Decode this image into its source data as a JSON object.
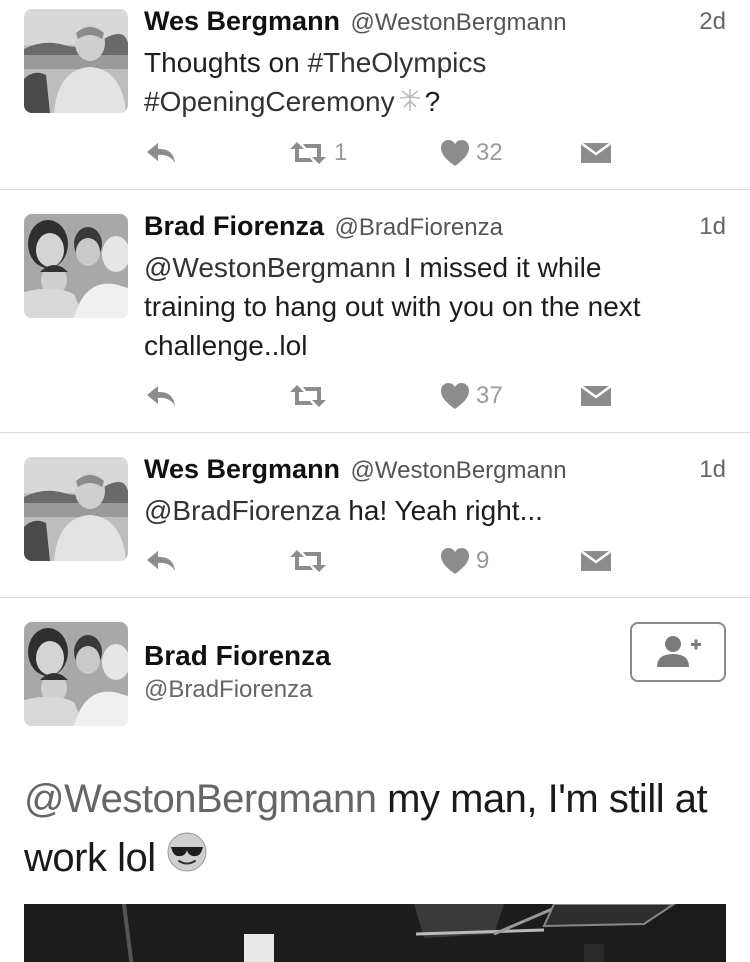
{
  "tweets": [
    {
      "name": "Wes Bergmann",
      "handle": "@WestonBergmann",
      "time": "2d",
      "text_parts": [
        "Thoughts on ",
        "#TheOlympics",
        "#OpeningCeremony",
        "?"
      ],
      "retweets": "1",
      "likes": "32"
    },
    {
      "name": "Brad Fiorenza",
      "handle": "@BradFiorenza",
      "time": "1d",
      "text_parts": [
        "@WestonBergmann",
        " I missed it while",
        "training to hang out with you on the next",
        "challenge..lol"
      ],
      "retweets": "",
      "likes": "37"
    },
    {
      "name": "Wes Bergmann",
      "handle": "@WestonBergmann",
      "time": "1d",
      "text_parts": [
        "@BradFiorenza",
        " ha! Yeah right..."
      ],
      "retweets": "",
      "likes": "9"
    }
  ],
  "expanded": {
    "name": "Brad Fiorenza",
    "handle": "@BradFiorenza",
    "text_mention": "@WestonBergmann",
    "text_line1": " my man, I'm still at",
    "text_line2": "work lol",
    "emoji_icon": "sunglasses-emoji-icon",
    "follow_icon": "follow-user-icon"
  },
  "icons": {
    "reply": "reply-icon",
    "retweet": "retweet-icon",
    "like": "heart-icon",
    "dm": "direct-message-icon"
  },
  "colors": {
    "action_gray": "#8c8c8c",
    "divider": "#d9d9d9"
  }
}
